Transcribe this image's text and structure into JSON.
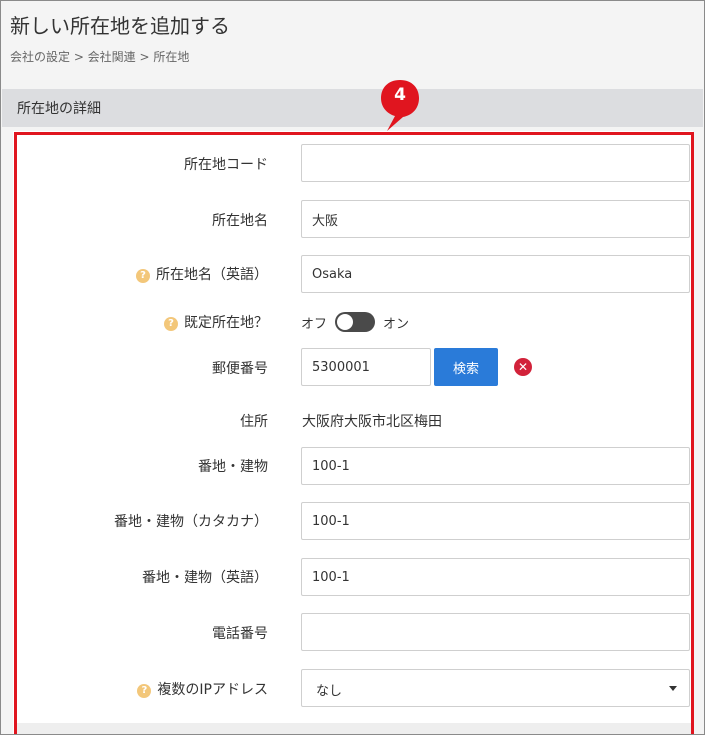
{
  "page": {
    "title": "新しい所在地を追加する",
    "breadcrumb": "会社の設定 > 会社関連 > 所在地"
  },
  "section": {
    "title": "所在地の詳細",
    "step_badge": "4"
  },
  "form": {
    "location_code": {
      "label": "所在地コード",
      "value": ""
    },
    "location_name": {
      "label": "所在地名",
      "value": "大阪"
    },
    "location_name_en": {
      "label": "所在地名（英語）",
      "value": "Osaka"
    },
    "default_location": {
      "label": "既定所在地？",
      "off_label": "オフ",
      "on_label": "オン",
      "on": false
    },
    "postal_code": {
      "label": "郵便番号",
      "value": "5300001",
      "search_label": "検索"
    },
    "address": {
      "label": "住所",
      "value": "大阪府大阪市北区梅田"
    },
    "street": {
      "label": "番地・建物",
      "value": "100-1"
    },
    "street_kana": {
      "label": "番地・建物（カタカナ）",
      "value": "100-1"
    },
    "street_en": {
      "label": "番地・建物（英語）",
      "value": "100-1"
    },
    "phone": {
      "label": "電話番号",
      "value": ""
    },
    "multiple_ip": {
      "label": "複数のIPアドレス",
      "value": "なし"
    }
  },
  "colors": {
    "highlight": "#e0151f",
    "primary_button": "#2a7bd9",
    "help_icon": "#f3c77a",
    "clear_icon": "#d2223a",
    "toggle_off": "#4a4a4a"
  },
  "icons": {
    "help": "question-circle-icon",
    "clear": "close-circle-icon",
    "select": "caret-down-icon"
  }
}
